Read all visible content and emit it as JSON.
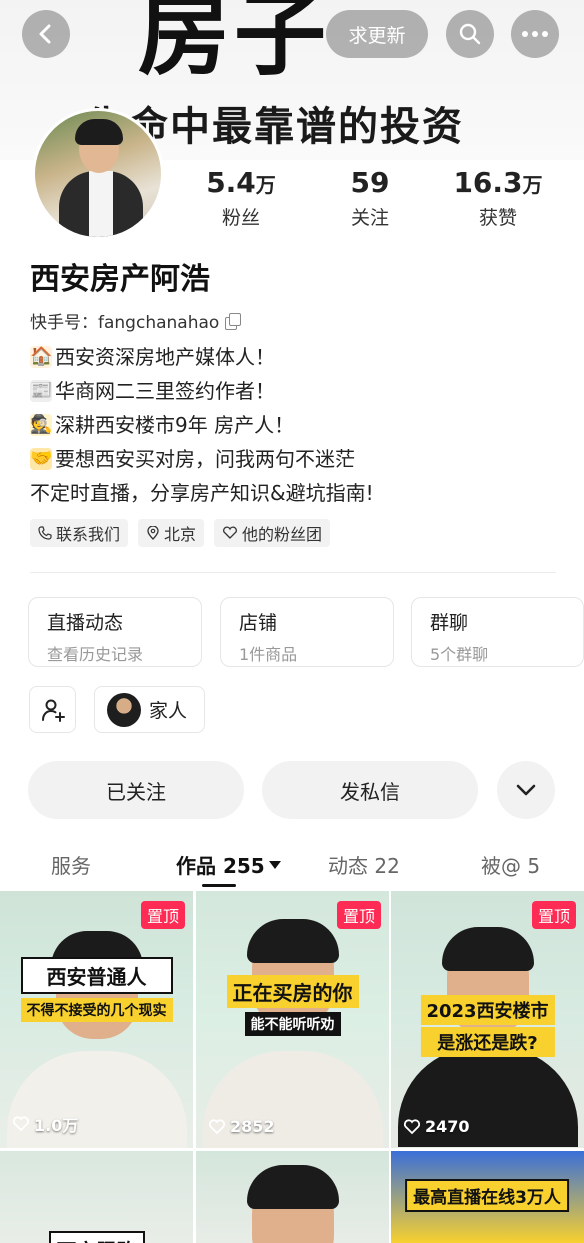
{
  "cover": {
    "big_text": "房子",
    "line_text": "生命中最靠谱的投资"
  },
  "topbar": {
    "update_label": "求更新"
  },
  "stats": [
    {
      "num": "5.4",
      "unit": "万",
      "label": "粉丝"
    },
    {
      "num": "59",
      "unit": "",
      "label": "关注"
    },
    {
      "num": "16.3",
      "unit": "万",
      "label": "获赞"
    }
  ],
  "profile": {
    "name": "西安房产阿浩",
    "uid": "快手号：fangchanahao",
    "bio": [
      {
        "emoji": "🏠",
        "text": "西安资深房地产媒体人！"
      },
      {
        "emoji": "📰",
        "text": "华商网二三里签约作者！"
      },
      {
        "emoji": "🕵",
        "text": "深耕西安楼市9年 房产人！"
      },
      {
        "emoji": "🤝",
        "text": "要想西安买对房，问我两句不迷茫"
      },
      {
        "emoji": "",
        "text": "不定时直播，分享房产知识&避坑指南!"
      }
    ],
    "tags": [
      "联系我们",
      "北京",
      "他的粉丝团"
    ]
  },
  "cards": [
    {
      "title": "直播动态",
      "sub": "查看历史记录"
    },
    {
      "title": "店铺",
      "sub": "1件商品"
    },
    {
      "title": "群聊",
      "sub": "5个群聊"
    }
  ],
  "family_label": "家人",
  "buttons": {
    "followed": "已关注",
    "message": "发私信"
  },
  "tabs": [
    {
      "label": "服务"
    },
    {
      "label": "作品 255"
    },
    {
      "label": "动态 22"
    },
    {
      "label": "被@ 5"
    }
  ],
  "videos": [
    {
      "pin": "置顶",
      "likes": "1.0万",
      "cap1": "西安普通人",
      "cap2": "不得不接受的几个现实"
    },
    {
      "pin": "置顶",
      "likes": "2852",
      "cap1": "正在买房的你",
      "cap2": "能不能听听劝"
    },
    {
      "pin": "置顶",
      "likes": "2470",
      "cap1": "2023西安楼市",
      "cap2": "是涨还是跌?"
    }
  ],
  "bottom_row": {
    "cap_left": "西安限购",
    "cap_right": "最高直播在线3万人"
  }
}
